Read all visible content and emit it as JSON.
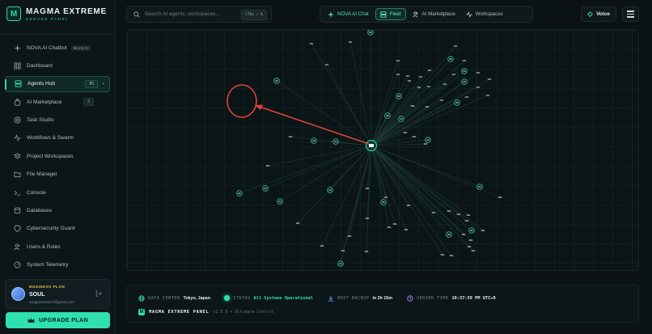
{
  "brand": {
    "title": "MAGMA EXTREME",
    "subtitle": "SERVER PANEL",
    "logo_letter": "M"
  },
  "sidebar": {
    "items": [
      {
        "label": "NOVA AI Chatbot",
        "icon": "sparkle-icon",
        "tag": "MAIN AI"
      },
      {
        "label": "Dashboard",
        "icon": "grid-icon"
      },
      {
        "label": "Agents Hub",
        "icon": "server-icon",
        "count": "85",
        "active": true
      },
      {
        "label": "AI Marketplace",
        "icon": "bag-icon",
        "count": "3"
      },
      {
        "label": "Task Studio",
        "icon": "target-icon"
      },
      {
        "label": "Workflows & Swarm",
        "icon": "pulse-icon"
      },
      {
        "label": "Project Workspaces",
        "icon": "layers-icon"
      },
      {
        "label": "File Manager",
        "icon": "folder-icon"
      },
      {
        "label": "Console",
        "icon": "terminal-icon"
      },
      {
        "label": "Databases",
        "icon": "database-icon"
      },
      {
        "label": "Cybersecurity Guard",
        "icon": "shield-icon"
      },
      {
        "label": "Users & Roles",
        "icon": "users-icon"
      },
      {
        "label": "System Telemetry",
        "icon": "gauge-icon"
      }
    ]
  },
  "plan": {
    "label": "BUSINESS PLAN",
    "user": "SOUL",
    "email": "soulgamemarcof@gmail.com"
  },
  "upgrade": {
    "label": "UPGRADE PLAN"
  },
  "search": {
    "placeholder": "Search AI agents, workspaces..",
    "shortcut": "CTRL / K"
  },
  "topnav": {
    "tabs": [
      {
        "label": "NOVA AI Chat",
        "icon": "sparkle-icon",
        "style": "green"
      },
      {
        "label": "Fleet",
        "icon": "server-icon",
        "style": "active"
      },
      {
        "label": "AI Marketplace",
        "icon": "users-icon",
        "style": ""
      },
      {
        "label": "Workspaces",
        "icon": "pulse-icon",
        "style": ""
      }
    ],
    "voice": "Voice"
  },
  "status": {
    "datacenter_key": "DATA CENTER",
    "datacenter_val": "Tokyo, Japan",
    "status_key": "STATUS",
    "status_val": "All Systems Operational",
    "backup_key": "NEXT BACKUP",
    "backup_val": "in 2h 15m",
    "time_key": "SERVER TIME",
    "time_val": "10:37:59 PM UTC+9"
  },
  "footer": {
    "name": "MAGMA EXTREME PANEL",
    "version": "v2.5.0 • Ultimate Control"
  },
  "colors": {
    "accent": "#2fe0b0",
    "annotation": "#e0443a",
    "gold": "#e3c04a"
  }
}
